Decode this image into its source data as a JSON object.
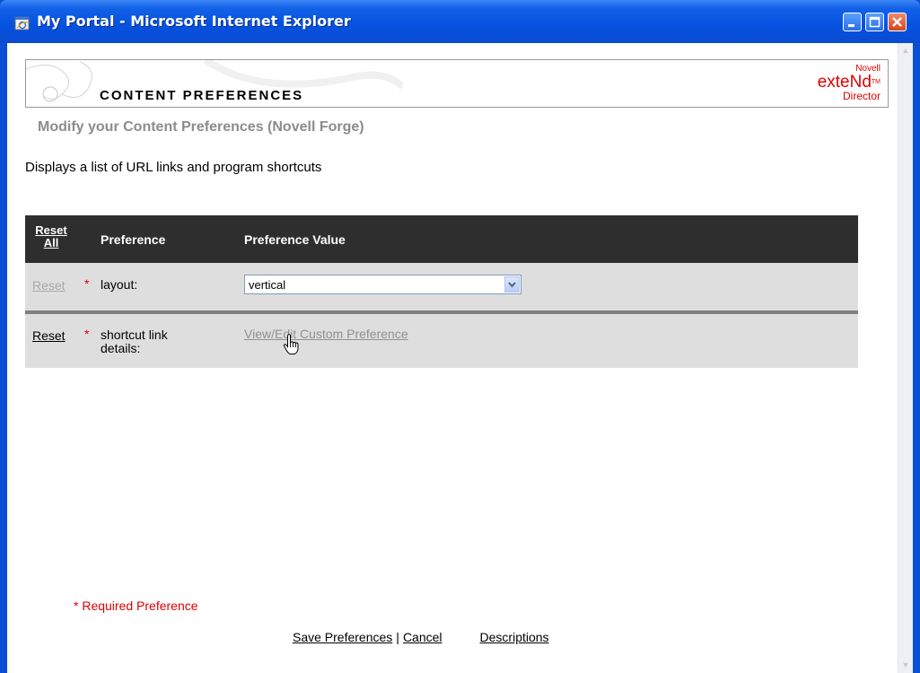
{
  "window": {
    "title": "My Portal - Microsoft Internet Explorer"
  },
  "banner": {
    "title": "CONTENT PREFERENCES",
    "logo": {
      "brand": "Novell",
      "product": "exteNd",
      "trademark": "TM",
      "subproduct": "Director"
    }
  },
  "subtitle": "Modify your Content Preferences (Novell Forge)",
  "description": "Displays a list of URL links and program shortcuts",
  "table": {
    "reset_all_line1": "Reset",
    "reset_all_line2": "All",
    "col_preference": "Preference",
    "col_value": "Preference Value",
    "rows": [
      {
        "reset": "Reset",
        "required_mark": "*",
        "label": "layout:",
        "value": "vertical"
      },
      {
        "reset": "Reset",
        "required_mark": "*",
        "label_line1": "shortcut link",
        "label_line2": "details:",
        "value_link": "View/Edit Custom Preference"
      }
    ]
  },
  "footer": {
    "required_note": "* Required Preference",
    "save": "Save Preferences",
    "separator": "|",
    "cancel": "Cancel",
    "descriptions": "Descriptions"
  },
  "colors": {
    "titlebar": "#0551df",
    "header_row": "#2e2e2e",
    "row_bg": "#dedede",
    "required": "#e00000",
    "disabled_text": "#a8a8a8"
  }
}
